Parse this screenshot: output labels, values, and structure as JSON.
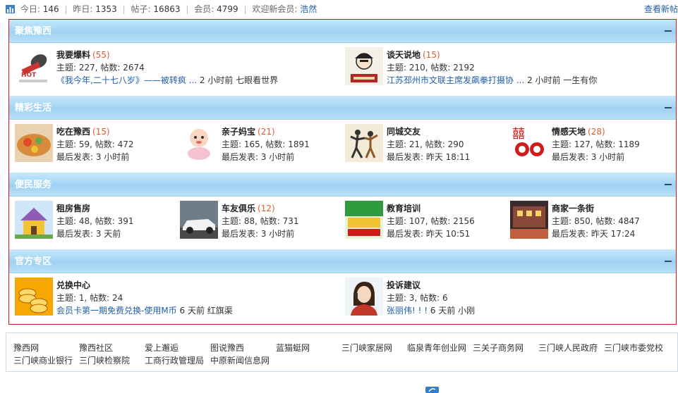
{
  "stats": {
    "today_label": "今日:",
    "today": "146",
    "yesterday_label": "昨日:",
    "yesterday": "1353",
    "posts_label": "帖子:",
    "posts": "16863",
    "members_label": "会员:",
    "members": "4799",
    "welcome_label": "欢迎新会员:",
    "newest_member": "浩然",
    "view_new": "查看新帖"
  },
  "categories": [
    {
      "title": "聚焦豫西",
      "forums": [
        {
          "name": "我要爆料",
          "today": "(55)",
          "line2": "主题: 227, 帖数: 2674",
          "last_title": "《我今年,二十七八岁》——被转疯 ...",
          "last_info": " 2 小时前 七眼看世界"
        },
        {
          "name": "谈天说地",
          "today": "(15)",
          "line2": "主题: 210, 帖数: 2192",
          "last_title": "江苏邳州市文联主席发飙拳打摄协 ...",
          "last_info": " 2 小时前 一生有你"
        }
      ]
    },
    {
      "title": "精彩生活",
      "forums": [
        {
          "name": "吃在豫西",
          "today": "(15)",
          "line2": "主题: 59, 帖数: 472",
          "line3": "最后发表: 3 小时前"
        },
        {
          "name": "亲子妈宝",
          "today": "(21)",
          "line2": "主题: 165, 帖数: 1891",
          "line3": "最后发表: 3 小时前"
        },
        {
          "name": "同城交友",
          "today": "",
          "line2": "主题: 21, 帖数: 290",
          "line3": "最后发表: 昨天 18:11"
        },
        {
          "name": "情感天地",
          "today": "(28)",
          "line2": "主题: 127, 帖数: 1189",
          "line3": "最后发表: 3 小时前"
        }
      ]
    },
    {
      "title": "便民服务",
      "forums": [
        {
          "name": "租房售房",
          "today": "",
          "line2": "主题: 48, 帖数: 391",
          "line3": "最后发表: 3 天前"
        },
        {
          "name": "车友俱乐",
          "today": "(12)",
          "line2": "主题: 88, 帖数: 731",
          "line3": "最后发表: 3 小时前"
        },
        {
          "name": "教育培训",
          "today": "",
          "line2": "主题: 107, 帖数: 2156",
          "line3": "最后发表: 昨天 10:51"
        },
        {
          "name": "商家一条街",
          "today": "",
          "line2": "主题: 850, 帖数: 4847",
          "line3": "最后发表: 昨天 17:24"
        }
      ]
    },
    {
      "title": "官方专区",
      "forums": [
        {
          "name": "兑换中心",
          "today": "",
          "line2": "主题: 1, 帖数: 24",
          "last_title": "会员卡第一期免费兑换-使用M币",
          "last_info": " 6 天前 红旗渠"
        },
        {
          "name": "投诉建议",
          "today": "",
          "line2": "主题: 3, 帖数: 6",
          "last_title": "张丽伟! ! !",
          "last_info": " 6 天前 小刚"
        }
      ]
    }
  ],
  "links": [
    "豫西网",
    "豫西社区",
    "爱上邂逅",
    "图说豫西",
    "蓝猫蜓网",
    "三门峡家居网",
    "临泉青年创业网",
    "三关子商务网",
    "三门峡人民政府",
    "三门峡市委党校",
    "三门峡商业银行",
    "三门峡检察院",
    "工商行政管理局",
    "中原新闻信息网"
  ],
  "colors": {
    "accent_red": "#d11a1a",
    "link_blue": "#1f5ea8",
    "count_orange": "#e05a2d",
    "header_blue": "#a8d8f4"
  },
  "icons": {
    "stats": "bar-chart-icon",
    "collapse": "minus-icon"
  }
}
